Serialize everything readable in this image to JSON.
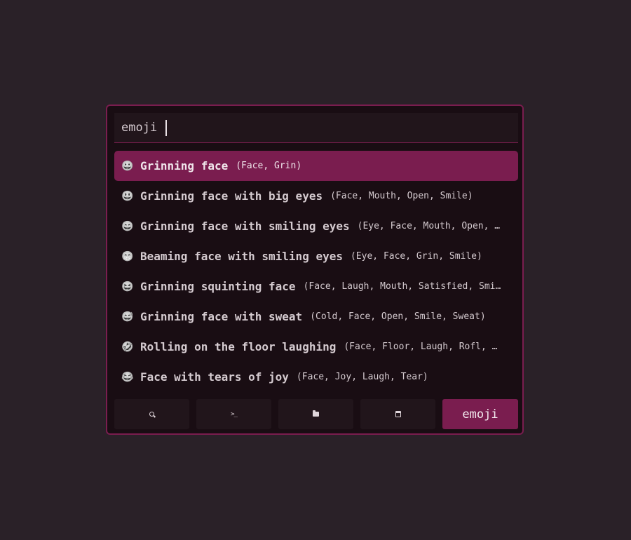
{
  "search": {
    "query": "emoji "
  },
  "results": [
    {
      "icon": "😀",
      "icon_name": "grinning-face-icon",
      "title": "Grinning face",
      "tags": "(Face, Grin)",
      "selected": true
    },
    {
      "icon": "😃",
      "icon_name": "grinning-face-with-big-eyes-icon",
      "title": "Grinning face with big eyes",
      "tags": "(Face, Mouth, Open, Smile)",
      "selected": false
    },
    {
      "icon": "😄",
      "icon_name": "grinning-face-with-smiling-eyes-icon",
      "title": "Grinning face with smiling eyes",
      "tags": "(Eye, Face, Mouth, Open, …",
      "selected": false
    },
    {
      "icon": "😁",
      "icon_name": "beaming-face-icon",
      "title": "Beaming face with smiling eyes",
      "tags": "(Eye, Face, Grin, Smile)",
      "selected": false
    },
    {
      "icon": "😆",
      "icon_name": "grinning-squinting-face-icon",
      "title": "Grinning squinting face",
      "tags": "(Face, Laugh, Mouth, Satisfied, Smi…",
      "selected": false
    },
    {
      "icon": "😅",
      "icon_name": "grinning-face-with-sweat-icon",
      "title": "Grinning face with sweat",
      "tags": "(Cold, Face, Open, Smile, Sweat)",
      "selected": false
    },
    {
      "icon": "🤣",
      "icon_name": "rolling-on-floor-laughing-icon",
      "title": "Rolling on the floor laughing",
      "tags": "(Face, Floor, Laugh, Rofl, …",
      "selected": false
    },
    {
      "icon": "😂",
      "icon_name": "face-with-tears-of-joy-icon",
      "title": "Face with tears of joy",
      "tags": "(Face, Joy, Laugh, Tear)",
      "selected": false
    }
  ],
  "modes": [
    {
      "icon_name": "search-icon",
      "label": ""
    },
    {
      "icon_name": "terminal-icon",
      "label": ""
    },
    {
      "icon_name": "folder-icon",
      "label": ""
    },
    {
      "icon_name": "window-icon",
      "label": ""
    },
    {
      "icon_name": "",
      "label": "emoji",
      "active": true
    }
  ],
  "colors": {
    "background": "#2a2128",
    "panel": "#190d13",
    "accent": "#7a1d4f",
    "input": "#21151b"
  }
}
